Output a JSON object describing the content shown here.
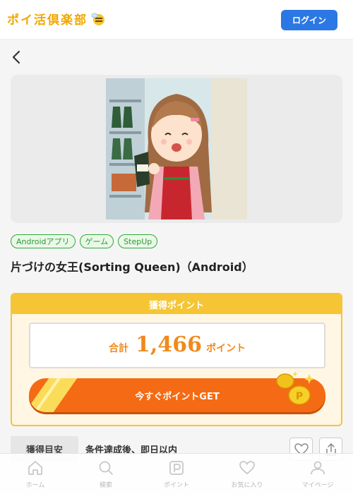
{
  "header": {
    "logo_text": "ポイ活倶楽部",
    "login_label": "ログイン"
  },
  "tags": [
    "Androidアプリ",
    "ゲーム",
    "StepUp"
  ],
  "offer": {
    "title": "片づけの女王(Sorting Queen)（Android）"
  },
  "points": {
    "header": "獲得ポイント",
    "total_label": "合計",
    "value": "1,466",
    "unit": "ポイント",
    "cta_label": "今すぐポイントGET"
  },
  "estimate": {
    "label": "獲得目安",
    "value": "条件達成後、即日以内"
  },
  "nav": {
    "items": [
      {
        "label": "ホーム",
        "icon": "home-icon"
      },
      {
        "label": "検索",
        "icon": "search-icon"
      },
      {
        "label": "ポイント",
        "icon": "point-icon"
      },
      {
        "label": "お気に入り",
        "icon": "heart-icon"
      },
      {
        "label": "マイページ",
        "icon": "user-icon"
      }
    ]
  },
  "colors": {
    "brand": "#f0a800",
    "login": "#2b78e4",
    "tag_green": "#2c9a37",
    "points_gold": "#f5c535",
    "cta_orange": "#f56a14"
  }
}
